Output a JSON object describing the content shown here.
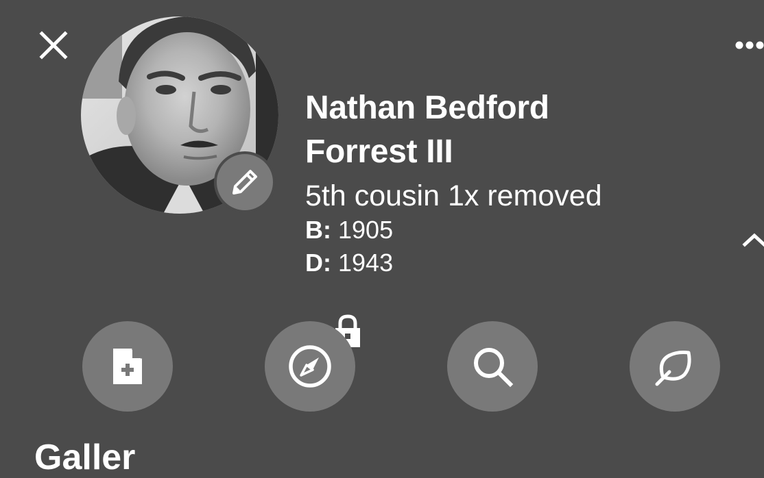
{
  "header": {
    "close_icon": "close-icon",
    "more_icon": "more-horizontal-icon",
    "collapse_icon": "chevron-up-icon"
  },
  "person": {
    "name_line1": "Nathan Bedford",
    "name_line2": "Forrest III",
    "relationship": "5th cousin 1x removed",
    "birth_label": "B:",
    "birth_value": " 1905",
    "death_label": "D:",
    "death_value": " 1943",
    "edit_photo_icon": "pencil-icon"
  },
  "actions": [
    {
      "name": "add-document",
      "icon": "document-add-icon"
    },
    {
      "name": "explore",
      "icon": "compass-icon",
      "locked": true
    },
    {
      "name": "search",
      "icon": "search-icon"
    },
    {
      "name": "hints",
      "icon": "leaf-icon"
    }
  ],
  "next_section_peek": "Galler",
  "colors": {
    "background": "#4b4b4b",
    "button": "#797979",
    "text": "#ffffff"
  }
}
